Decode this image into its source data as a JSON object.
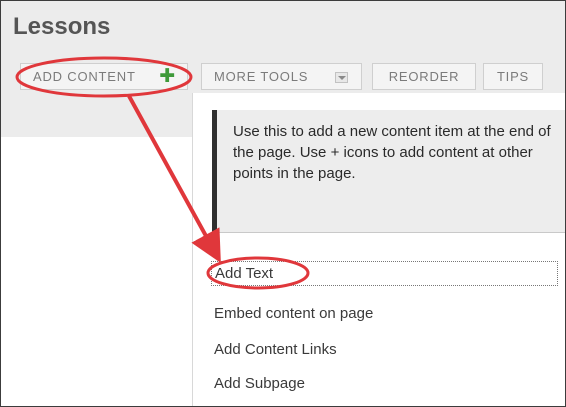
{
  "page": {
    "title": "Lessons"
  },
  "toolbar": {
    "add_content_label": "ADD CONTENT",
    "more_tools_label": "MORE TOOLS",
    "reorder_label": "REORDER",
    "tips_label": "TIPS"
  },
  "tooltip": {
    "text": "Use this to add a new content item at the end of the page. Use + icons to add content at other points in the page."
  },
  "menu": {
    "items": [
      {
        "label": "Add Text"
      },
      {
        "label": "Embed content on page"
      },
      {
        "label": "Add Content Links"
      },
      {
        "label": "Add Subpage"
      }
    ]
  },
  "colors": {
    "plus_icon": "#3f9a3a",
    "annotation": "#e0373b",
    "header_bg": "#ececec"
  },
  "icons": [
    "plus-icon",
    "chevron-down-icon"
  ]
}
